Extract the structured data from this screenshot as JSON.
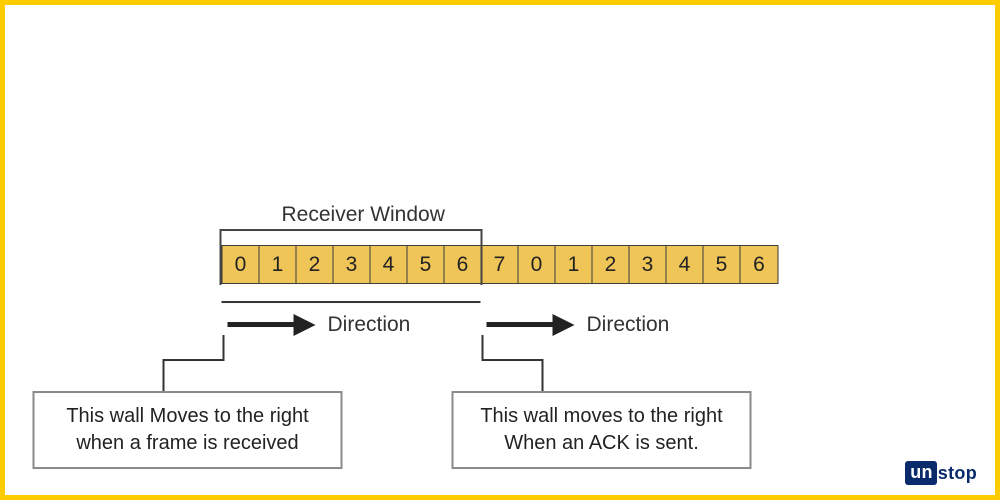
{
  "title": "Receiver Window",
  "cells": [
    "0",
    "1",
    "2",
    "3",
    "4",
    "5",
    "6",
    "7",
    "0",
    "1",
    "2",
    "3",
    "4",
    "5",
    "6"
  ],
  "window": {
    "start_index": 0,
    "end_index": 6
  },
  "direction_label": "Direction",
  "caption_left": "This wall Moves to the right when a frame is received",
  "caption_right": "This wall moves to the right When an ACK is sent.",
  "logo": {
    "prefix": "un",
    "suffix": "stop"
  },
  "colors": {
    "border": "#ffcc00",
    "cell": "#efc558",
    "text": "#333",
    "logo": "#0a2b6b"
  }
}
